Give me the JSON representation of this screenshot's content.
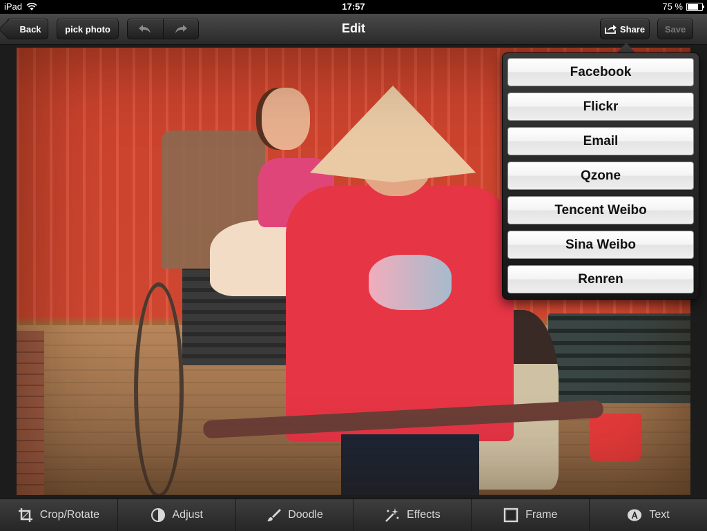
{
  "status_bar": {
    "device": "iPad",
    "time": "17:57",
    "battery_percent": "75 %",
    "battery_level": 0.75
  },
  "nav_bar": {
    "back_label": "Back",
    "pick_photo_label": "pick photo",
    "undo_icon": "undo-arrow-icon",
    "redo_icon": "redo-arrow-icon",
    "title": "Edit",
    "share_label": "Share",
    "save_label": "Save"
  },
  "share_menu": {
    "items": [
      "Facebook",
      "Flickr",
      "Email",
      "Qzone",
      "Tencent Weibo",
      "Sina Weibo",
      "Renren"
    ]
  },
  "toolbar": {
    "items": [
      {
        "label": "Crop/Rotate",
        "icon": "crop-icon"
      },
      {
        "label": "Adjust",
        "icon": "contrast-icon"
      },
      {
        "label": "Doodle",
        "icon": "brush-icon"
      },
      {
        "label": "Effects",
        "icon": "sparkle-wand-icon"
      },
      {
        "label": "Frame",
        "icon": "frame-icon"
      },
      {
        "label": "Text",
        "icon": "text-icon"
      }
    ]
  },
  "colors": {
    "share_item_bg": "#f2f2f2",
    "toolbar_text": "#d8d8d8",
    "disabled_text": "#777777"
  }
}
